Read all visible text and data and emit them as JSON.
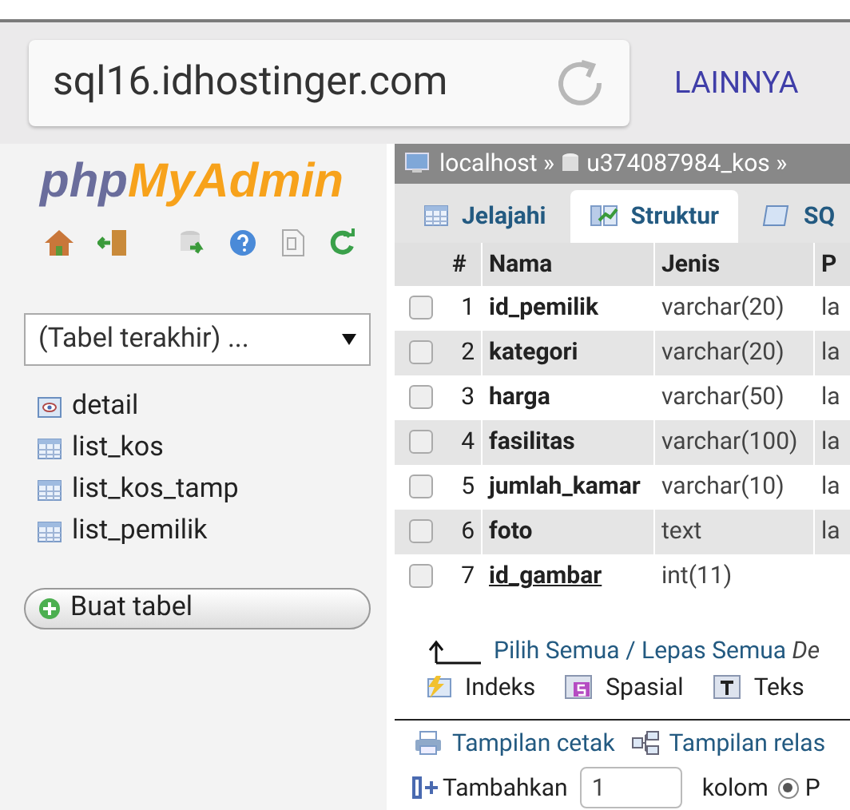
{
  "browser": {
    "url": "sql16.idhostinger.com",
    "menu_button": "LAINNYA"
  },
  "sidebar": {
    "logo_php": "php",
    "logo_rest": "MyAdmin",
    "recent_tables": {
      "value": "(Tabel terakhir) ..."
    },
    "tables": [
      {
        "name": "detail",
        "kind": "view"
      },
      {
        "name": "list_kos",
        "kind": "table"
      },
      {
        "name": "list_kos_tamp",
        "kind": "table"
      },
      {
        "name": "list_pemilik",
        "kind": "table"
      }
    ],
    "create_button": "Buat tabel"
  },
  "breadcrumb": [
    "localhost »",
    "u374087984_kos »"
  ],
  "tabs": [
    {
      "label": "Jelajahi",
      "selected": false,
      "kind": "browse"
    },
    {
      "label": "Struktur",
      "selected": true,
      "kind": "structure"
    },
    {
      "label": "SQ",
      "selected": false,
      "kind": "sql"
    }
  ],
  "table": {
    "columns": [
      "#",
      "Nama",
      "Jenis",
      "P"
    ],
    "rows": [
      {
        "number": "1",
        "name": "id_pemilik",
        "type": "varchar(20)",
        "column_4": "la",
        "checked": false,
        "primary": false
      },
      {
        "number": "2",
        "name": "kategori",
        "type": "varchar(20)",
        "column_4": "la",
        "checked": false,
        "primary": false
      },
      {
        "number": "3",
        "name": "harga",
        "type": "varchar(50)",
        "column_4": "la",
        "checked": false,
        "primary": false
      },
      {
        "number": "4",
        "name": "fasilitas",
        "type": "varchar(100)",
        "column_4": "la",
        "checked": false,
        "primary": false
      },
      {
        "number": "5",
        "name": "jumlah_kamar",
        "type": "varchar(10)",
        "column_4": "la",
        "checked": false,
        "primary": false
      },
      {
        "number": "6",
        "name": "foto",
        "type": "text",
        "column_4": "la",
        "checked": false,
        "primary": false
      },
      {
        "number": "7",
        "name": "id_gambar",
        "type": "int(11)",
        "checked": false,
        "primary": true
      }
    ]
  },
  "bulk": {
    "select_all": "Pilih Semua",
    "separator": "/",
    "deselect_all": "Lepas Semua",
    "with_selected": "De"
  },
  "actions": [
    {
      "label": "Indeks",
      "kind": "index"
    },
    {
      "label": "Spasial",
      "kind": "spatial"
    },
    {
      "label": "Teks",
      "kind": "text"
    }
  ],
  "links": [
    {
      "label": "Tampilan cetak",
      "kind": "print"
    },
    {
      "label": "Tampilan relas",
      "kind": "relation"
    }
  ],
  "add_columns": {
    "label": "Tambahkan",
    "value": "1",
    "unit": "kolom",
    "option": "P",
    "option_selected": true
  }
}
